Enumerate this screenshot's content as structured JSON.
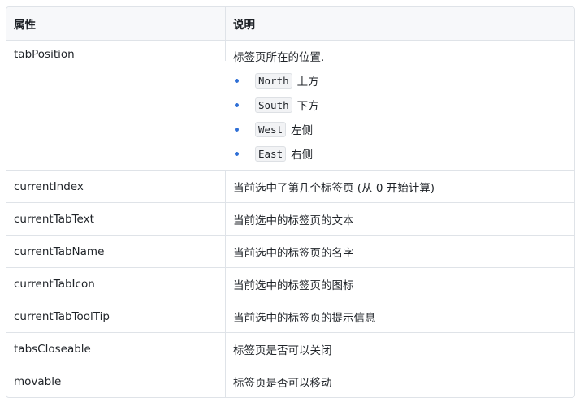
{
  "table": {
    "headers": {
      "attr": "属性",
      "desc": "说明"
    },
    "tabPosition": {
      "name": "tabPosition",
      "desc": "标签页所在的位置.",
      "options": [
        {
          "code": "North",
          "text": "上方"
        },
        {
          "code": "South",
          "text": "下方"
        },
        {
          "code": "West",
          "text": "左侧"
        },
        {
          "code": "East",
          "text": "右侧"
        }
      ]
    },
    "rows": [
      {
        "name": "currentIndex",
        "desc": "当前选中了第几个标签页 (从 0 开始计算)"
      },
      {
        "name": "currentTabText",
        "desc": "当前选中的标签页的文本"
      },
      {
        "name": "currentTabName",
        "desc": "当前选中的标签页的名字"
      },
      {
        "name": "currentTabIcon",
        "desc": "当前选中的标签页的图标"
      },
      {
        "name": "currentTabToolTip",
        "desc": "当前选中的标签页的提示信息"
      },
      {
        "name": "tabsCloseable",
        "desc": "标签页是否可以关闭"
      },
      {
        "name": "movable",
        "desc": "标签页是否可以移动"
      }
    ]
  }
}
